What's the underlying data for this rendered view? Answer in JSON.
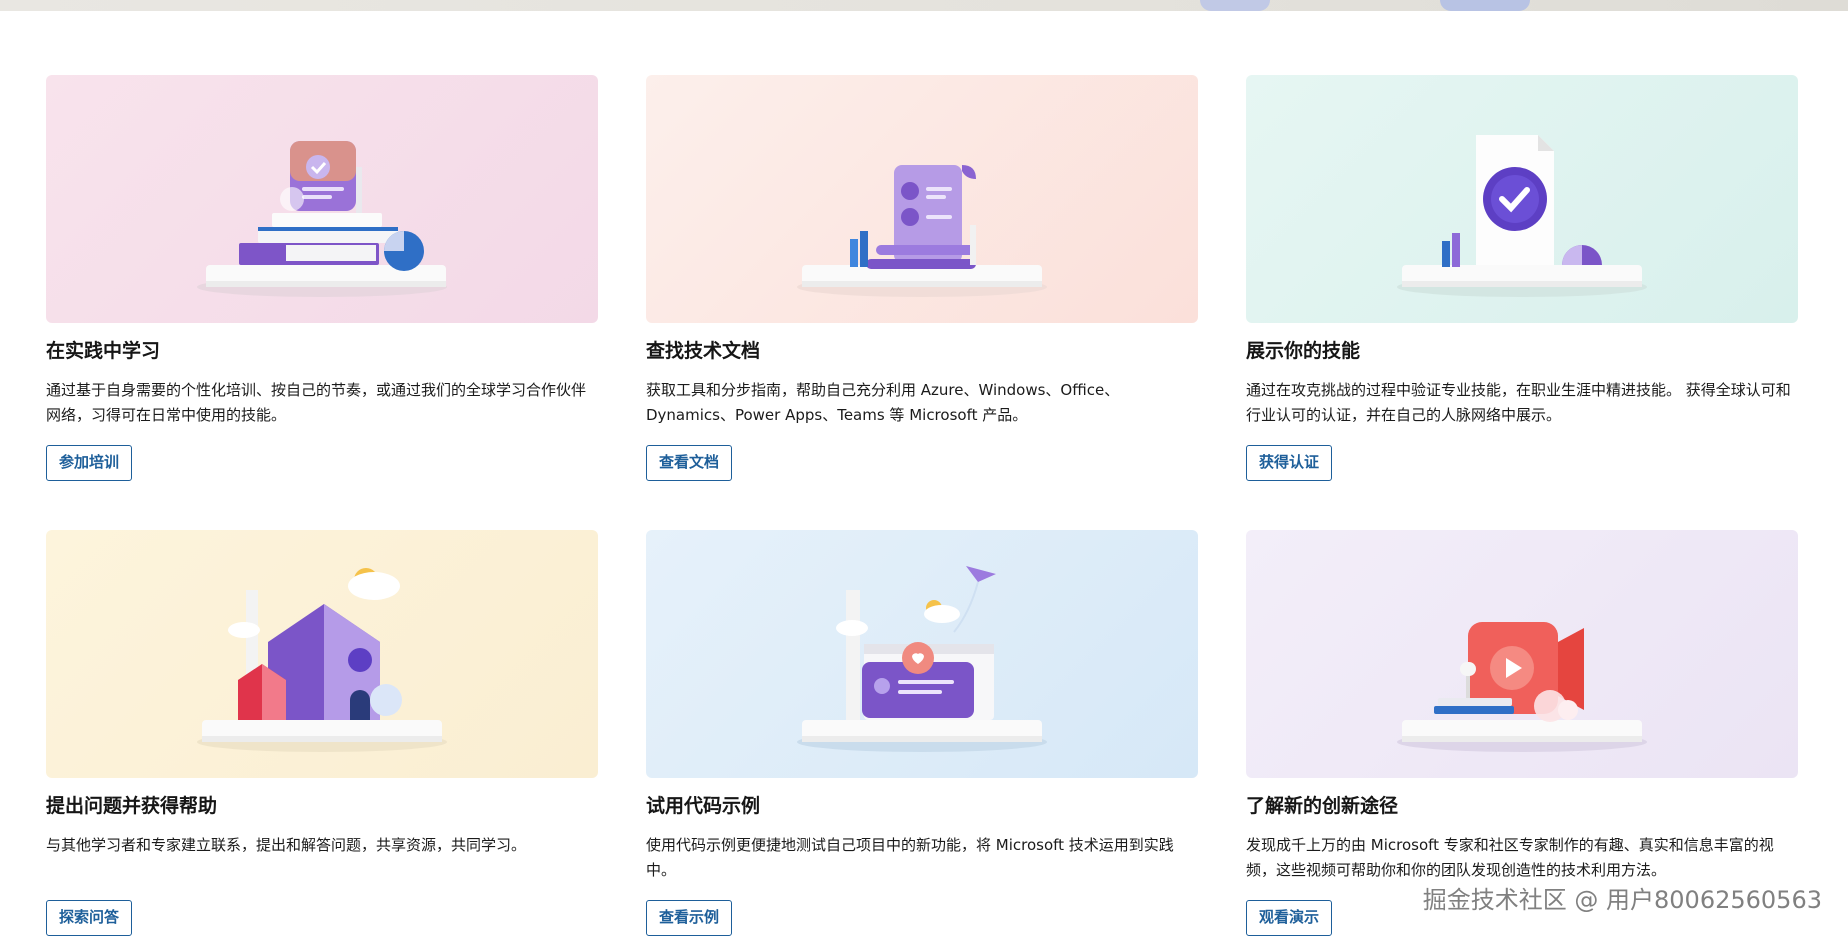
{
  "cards": [
    {
      "title": "在实践中学习",
      "desc": "通过基于自身需要的个性化培训、按自己的节奏，或通过我们的全球学习合作伙伴网络，习得可在日常中使用的技能。",
      "button": "参加培训",
      "bg": "#f6dde8"
    },
    {
      "title": "查找技术文档",
      "desc": "获取工具和分步指南，帮助自己充分利用 Azure、Windows、Office、Dynamics、Power Apps、Teams 等 Microsoft 产品。",
      "button": "查看文档",
      "bg": "#fbe6e3"
    },
    {
      "title": "展示你的技能",
      "desc": "通过在攻克挑战的过程中验证专业技能，在职业生涯中精进技能。 获得全球认可和行业认可的认证，并在自己的人脉网络中展示。",
      "button": "获得认证",
      "bg": "#ddf2ee"
    },
    {
      "title": "提出问题并获得帮助",
      "desc": "与其他学习者和专家建立联系，提出和解答问题，共享资源，共同学习。",
      "button": "探索问答",
      "bg": "#fbf1d8"
    },
    {
      "title": "试用代码示例",
      "desc": "使用代码示例更便捷地测试自己项目中的新功能，将 Microsoft 技术运用到实践中。",
      "button": "查看示例",
      "bg": "#dcebf8"
    },
    {
      "title": "了解新的创新途径",
      "desc": "发现成千上万的由 Microsoft 专家和社区专家制作的有趣、真实和信息丰富的视频，这些视频可帮助你和你的团队发现创造性的技术利用方法。",
      "button": "观看演示",
      "bg": "#eee8f6"
    }
  ],
  "watermark": "掘金技术社区 @ 用户80062560563",
  "colors": {
    "accent": "#1e5f9a",
    "purple": "#7b5bc6",
    "shelf": "#f2f2f2"
  }
}
